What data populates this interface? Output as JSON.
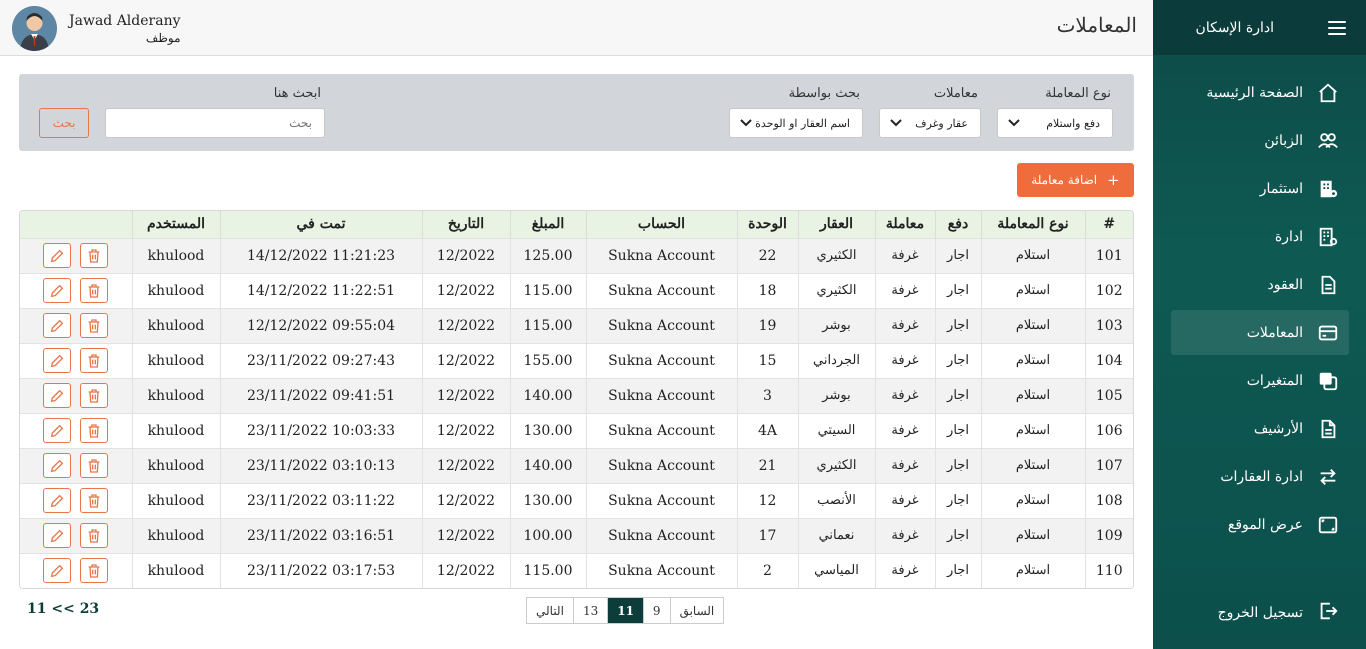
{
  "sidebar": {
    "app_title": "ادارة الإسكان",
    "items": [
      {
        "label": "الصفحة الرئيسية",
        "icon": "home-icon"
      },
      {
        "label": "الزبائن",
        "icon": "users-icon"
      },
      {
        "label": "استثمار",
        "icon": "building-icon"
      },
      {
        "label": "ادارة",
        "icon": "building-settings-icon"
      },
      {
        "label": "العقود",
        "icon": "document-icon"
      },
      {
        "label": "المعاملات",
        "icon": "card-icon",
        "active": true
      },
      {
        "label": "المتغيرات",
        "icon": "copy-icon"
      },
      {
        "label": "الأرشيف",
        "icon": "file-icon"
      },
      {
        "label": "ادارة العقارات",
        "icon": "swap-icon"
      },
      {
        "label": "عرض الموقع",
        "icon": "screen-icon"
      }
    ],
    "logout": "تسجيل الخروج"
  },
  "header": {
    "title": "المعاملات",
    "user_name": "Jawad Alderany",
    "user_role": "موظف"
  },
  "filters": {
    "type_label": "نوع المعاملة",
    "type_value": "دفع واستلام",
    "txn_label": "معاملات",
    "txn_value": "عقار وغرف",
    "by_label": "بحث بواسطة",
    "by_value": "اسم العقار او الوحدة",
    "search_label": "ابحث هنا",
    "search_placeholder": "بحث",
    "search_button": "بحث"
  },
  "add_button": "اضافة معاملة",
  "table": {
    "headers": [
      "#",
      "نوع المعاملة",
      "دفع",
      "معاملة",
      "العقار",
      "الوحدة",
      "الحساب",
      "المبلغ",
      "التاريخ",
      "تمت في",
      "المستخدم",
      ""
    ],
    "rows": [
      {
        "id": "101",
        "type": "استلام",
        "pay": "اجار",
        "txn": "غرفة",
        "property": "الكثيري",
        "unit": "22",
        "account": "Sukna Account",
        "amount": "125.00",
        "date": "12/2022",
        "done_at": "14/12/2022 11:21:23",
        "user": "khulood"
      },
      {
        "id": "102",
        "type": "استلام",
        "pay": "اجار",
        "txn": "غرفة",
        "property": "الكثيري",
        "unit": "18",
        "account": "Sukna Account",
        "amount": "115.00",
        "date": "12/2022",
        "done_at": "14/12/2022 11:22:51",
        "user": "khulood"
      },
      {
        "id": "103",
        "type": "استلام",
        "pay": "اجار",
        "txn": "غرفة",
        "property": "بوشر",
        "unit": "19",
        "account": "Sukna Account",
        "amount": "115.00",
        "date": "12/2022",
        "done_at": "12/12/2022 09:55:04",
        "user": "khulood"
      },
      {
        "id": "104",
        "type": "استلام",
        "pay": "اجار",
        "txn": "غرفة",
        "property": "الجرداني",
        "unit": "15",
        "account": "Sukna Account",
        "amount": "155.00",
        "date": "12/2022",
        "done_at": "23/11/2022 09:27:43",
        "user": "khulood"
      },
      {
        "id": "105",
        "type": "استلام",
        "pay": "اجار",
        "txn": "غرفة",
        "property": "بوشر",
        "unit": "3",
        "account": "Sukna Account",
        "amount": "140.00",
        "date": "12/2022",
        "done_at": "23/11/2022 09:41:51",
        "user": "khulood"
      },
      {
        "id": "106",
        "type": "استلام",
        "pay": "اجار",
        "txn": "غرفة",
        "property": "السيتي",
        "unit": "4A",
        "account": "Sukna Account",
        "amount": "130.00",
        "date": "12/2022",
        "done_at": "23/11/2022 10:03:33",
        "user": "khulood"
      },
      {
        "id": "107",
        "type": "استلام",
        "pay": "اجار",
        "txn": "غرفة",
        "property": "الكثيري",
        "unit": "21",
        "account": "Sukna Account",
        "amount": "140.00",
        "date": "12/2022",
        "done_at": "23/11/2022 03:10:13",
        "user": "khulood"
      },
      {
        "id": "108",
        "type": "استلام",
        "pay": "اجار",
        "txn": "غرفة",
        "property": "الأنصب",
        "unit": "12",
        "account": "Sukna Account",
        "amount": "130.00",
        "date": "12/2022",
        "done_at": "23/11/2022 03:11:22",
        "user": "khulood"
      },
      {
        "id": "109",
        "type": "استلام",
        "pay": "اجار",
        "txn": "غرفة",
        "property": "نعماني",
        "unit": "17",
        "account": "Sukna Account",
        "amount": "100.00",
        "date": "12/2022",
        "done_at": "23/11/2022 03:16:51",
        "user": "khulood"
      },
      {
        "id": "110",
        "type": "استلام",
        "pay": "اجار",
        "txn": "غرفة",
        "property": "المياسي",
        "unit": "2",
        "account": "Sukna Account",
        "amount": "115.00",
        "date": "12/2022",
        "done_at": "23/11/2022 03:17:53",
        "user": "khulood"
      }
    ]
  },
  "pagination": {
    "prev": "السابق",
    "pages": [
      "9",
      "11",
      "13"
    ],
    "current": "11",
    "next": "التالي",
    "info": "11 << 23"
  },
  "colors": {
    "sidebar": "#0d4a47",
    "accent": "#ef6c3c",
    "header_row": "#e8f3e4"
  }
}
